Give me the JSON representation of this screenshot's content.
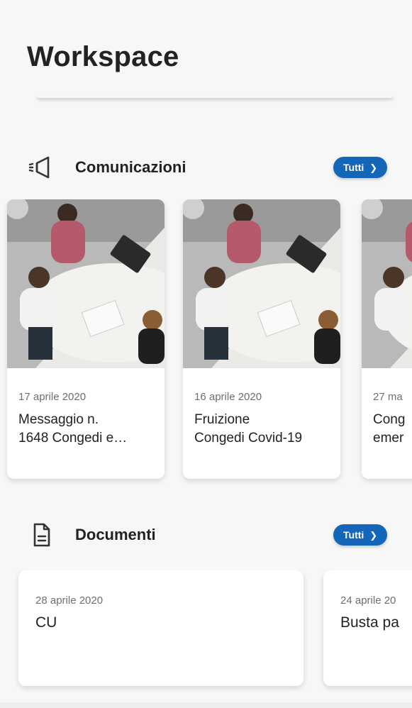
{
  "page": {
    "title": "Workspace"
  },
  "communications": {
    "section_label": "Comunicazioni",
    "section_icon": "megaphone-icon",
    "all_button_label": "Tutti",
    "cards": [
      {
        "date": "17 aprile 2020",
        "title": "Messaggio n.\n1648 Congedi e…"
      },
      {
        "date": "16 aprile 2020",
        "title": "Fruizione\nCongedi Covid-19"
      },
      {
        "date": "27 ma",
        "title": "Cong\nemer"
      }
    ]
  },
  "documents": {
    "section_label": "Documenti",
    "section_icon": "document-icon",
    "all_button_label": "Tutti",
    "cards": [
      {
        "date": "28 aprile 2020",
        "title": "CU"
      },
      {
        "date": "24 aprile 20",
        "title": "Busta pa"
      }
    ]
  },
  "colors": {
    "accent": "#1467b8",
    "background": "#f7f7f7",
    "card": "#ffffff"
  }
}
